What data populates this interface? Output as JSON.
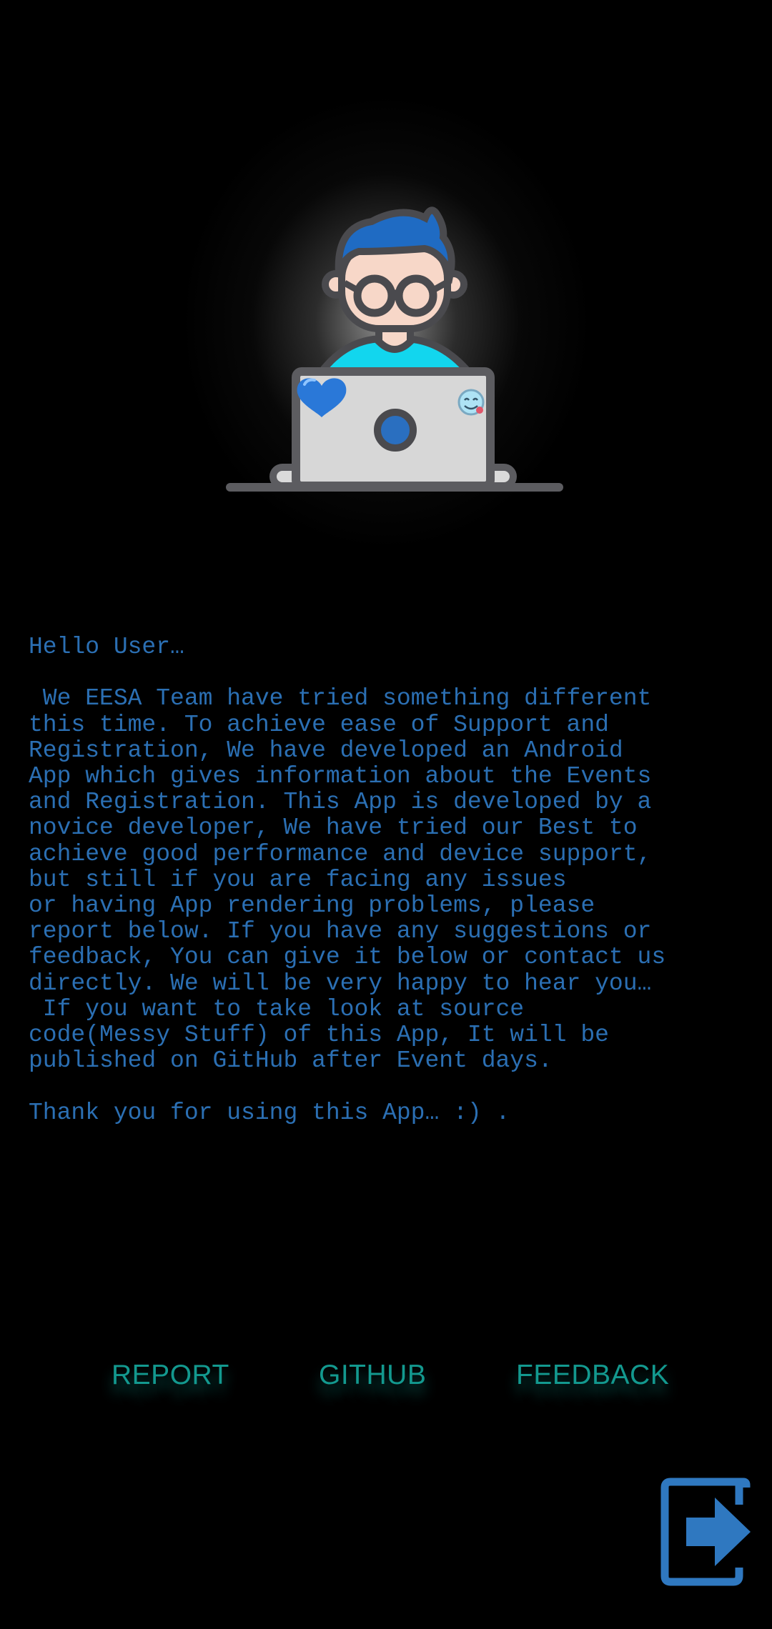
{
  "about": {
    "text": "Hello User…\n\n We EESA Team have tried something different\nthis time. To achieve ease of Support and\nRegistration, We have developed an Android\nApp which gives information about the Events\nand Registration. This App is developed by a\nnovice developer, We have tried our Best to\nachieve good performance and device support,\nbut still if you are facing any issues\nor having App rendering problems, please\nreport below. If you have any suggestions or\nfeedback, You can give it below or contact us\ndirectly. We will be very happy to hear you…\n If you want to take look at source\ncode(Messy Stuff) of this App, It will be\npublished on GitHub after Event days.\n\nThank you for using this App… :) ."
  },
  "actions": {
    "report_label": "REPORT",
    "github_label": "GITHUB",
    "feedback_label": "FEEDBACK"
  },
  "icons": {
    "hero": "developer-at-laptop-icon",
    "exit": "exit-door-arrow-icon"
  },
  "colors": {
    "background": "#000000",
    "body_text": "#2b6fb3",
    "action_text": "#13998f",
    "exit_icon": "#2f78c0"
  }
}
